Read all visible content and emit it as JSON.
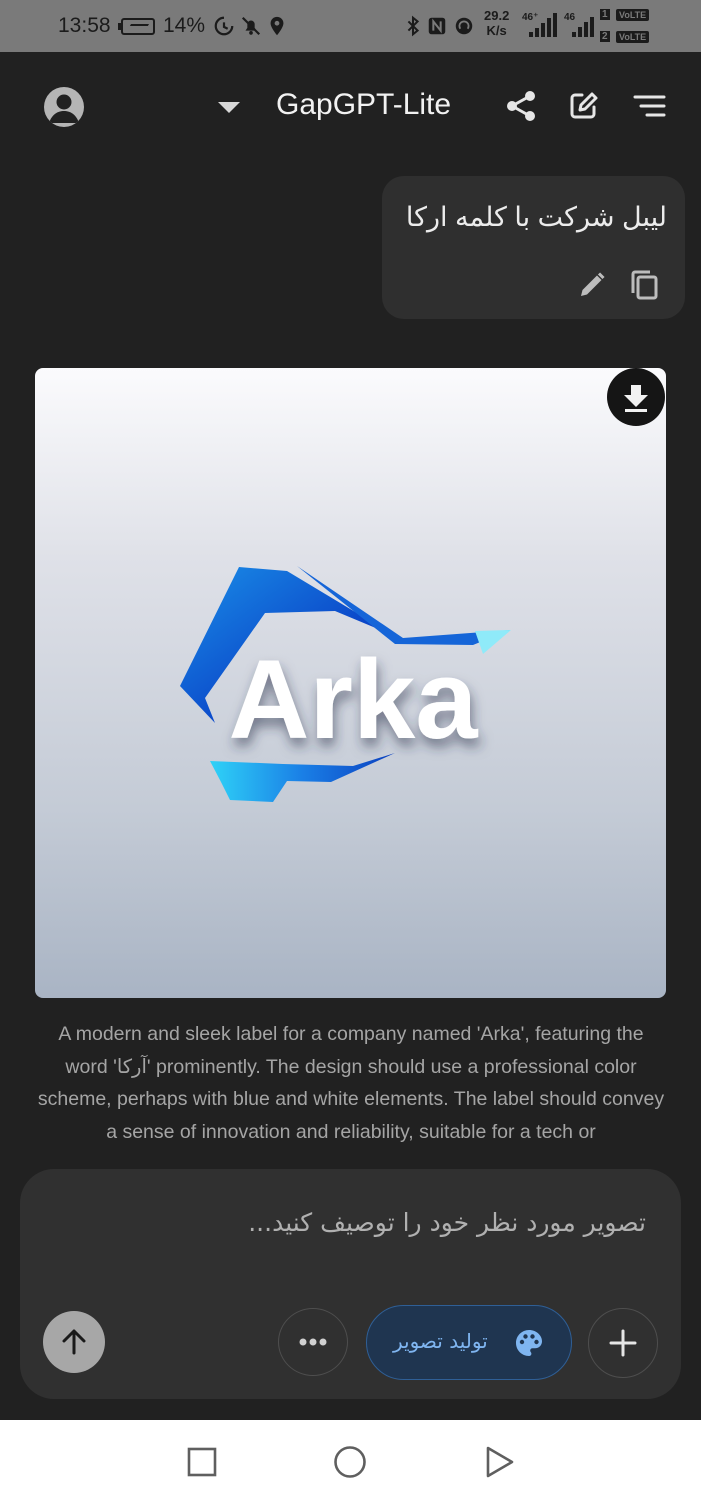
{
  "status_bar": {
    "time": "13:58",
    "battery": "14%",
    "net_speed_value": "29.2",
    "net_speed_unit": "K/s",
    "signal_1": "46⁺",
    "signal_2": "46",
    "sim_1": "1",
    "sim_2": "2",
    "volte": "VoLTE"
  },
  "header": {
    "title": "GapGPT-Lite",
    "icons": [
      "account-icon",
      "chevron-down-icon",
      "share-icon",
      "edit-icon",
      "menu-icon"
    ]
  },
  "chat": {
    "user_message": "لیبل شرکت با کلمه ارکا",
    "generated_image": {
      "logo_text": "Arka",
      "colors": {
        "blue_dark": "#0b3fbf",
        "blue_light": "#33c5f3"
      }
    },
    "caption": "A modern and sleek label for a company named 'Arka', featuring the word 'آرکا' prominently. The design should use a professional color scheme, perhaps with blue and white elements. The label should convey a sense of innovation and reliability, suitable for a tech or"
  },
  "composer": {
    "placeholder": "تصویر مورد نظر خود را توصیف کنید...",
    "generate_label": "تولید تصویر"
  },
  "colors": {
    "background": "#212121",
    "bubble": "#2f2f2f",
    "composer": "#303030",
    "accent": "#7fb5f0"
  }
}
